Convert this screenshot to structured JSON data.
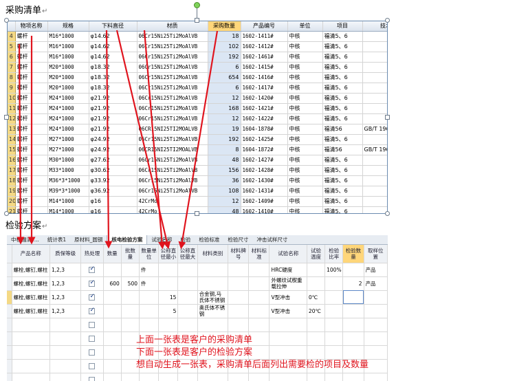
{
  "purchase_heading": "采购清单",
  "plan_heading": "检验方案",
  "para_mark": "↵",
  "purchase": {
    "columns": [
      "物项名称",
      "规格",
      "下料直径",
      "材质",
      "采购数量",
      "产品编号",
      "单位",
      "项目",
      "技术参数"
    ],
    "rows": [
      [
        "4",
        "螺杆",
        "M16*1000",
        "φ14.62",
        "06Cr15Ni25Ti2MoAlVB",
        "18",
        "1602-1411#",
        "中核",
        "福清5、6",
        ""
      ],
      [
        "5",
        "螺杆",
        "M16*1000",
        "φ14.62",
        "06Cr15Ni25Ti2MoAlVB",
        "102",
        "1602-1412#",
        "中核",
        "福清5、6",
        ""
      ],
      [
        "6",
        "螺杆",
        "M16*1000",
        "φ14.62",
        "06Cr15Ni25Ti2MoAlVB",
        "192",
        "1602-1461#",
        "中核",
        "福清5、6",
        ""
      ],
      [
        "7",
        "螺杆",
        "M20*1000",
        "φ18.32",
        "06Cr15Ni25Ti2MoAlVB",
        "6",
        "1602-1415#",
        "中核",
        "福清5、6",
        ""
      ],
      [
        "8",
        "螺杆",
        "M20*1000",
        "φ18.32",
        "06Cr15Ni25Ti2MoAlVB",
        "654",
        "1602-1416#",
        "中核",
        "福清5、6",
        ""
      ],
      [
        "9",
        "螺杆",
        "M20*1000",
        "φ18.32",
        "06Cr15Ni25Ti2MoAlVB",
        "6",
        "1602-1417#",
        "中核",
        "福清5、6",
        ""
      ],
      [
        "10",
        "螺杆",
        "M24*1000",
        "φ21.92",
        "06Cr15Ni25Ti2MoAlVB",
        "12",
        "1602-1420#",
        "中核",
        "福清5、6",
        ""
      ],
      [
        "11",
        "螺杆",
        "M24*1000",
        "φ21.92",
        "06Cr15Ni25Ti2MoAlVB",
        "168",
        "1602-1421#",
        "中核",
        "福清5、6",
        ""
      ],
      [
        "12",
        "螺杆",
        "M24*1000",
        "φ21.92",
        "06Cr15Ni25Ti2MoAlVB",
        "12",
        "1602-1422#",
        "中核",
        "福清5、6",
        ""
      ],
      [
        "13",
        "螺杆",
        "M24*1000",
        "φ21.92",
        "06CR15NI25TI2MOALVB",
        "19",
        "1604-1878#",
        "中核",
        "福清56",
        "GB/T 196"
      ],
      [
        "14",
        "螺杆",
        "M27*1000",
        "φ24.92",
        "06Cr15Ni25Ti2MoAlVB",
        "192",
        "1602-1425#",
        "中核",
        "福清5、6",
        ""
      ],
      [
        "15",
        "螺杆",
        "M27*1000",
        "φ24.92",
        "06CR15NI25TI2MOALVB",
        "8",
        "1604-1872#",
        "中核",
        "福清56",
        "GB/T 196"
      ],
      [
        "16",
        "螺杆",
        "M30*1000",
        "φ27.62",
        "06Cr15Ni25Ti2MoAlVB",
        "48",
        "1602-1427#",
        "中核",
        "福清5、6",
        ""
      ],
      [
        "17",
        "螺杆",
        "M33*1000",
        "φ30.62",
        "06Cr15Ni25Ti2MoAlVB",
        "156",
        "1602-1428#",
        "中核",
        "福清5、6",
        ""
      ],
      [
        "18",
        "螺杆",
        "M36*3*1000",
        "φ33.92",
        "06Cr15Ni25Ti2MoAlVB",
        "36",
        "1602-1430#",
        "中核",
        "福清5、6",
        ""
      ],
      [
        "19",
        "螺杆",
        "M39*3*1000",
        "φ36.92",
        "06Cr15Ni25Ti2MoAlVB",
        "108",
        "1602-1431#",
        "中核",
        "福清5、6",
        ""
      ],
      [
        "20",
        "螺杆",
        "M14*1000",
        "φ16",
        "42CrMo",
        "12",
        "1602-1409#",
        "中核",
        "福清5、6",
        ""
      ],
      [
        "21",
        "螺杆",
        "M14*1000",
        "φ16",
        "42CrMo",
        "48",
        "1602-1410#",
        "中核",
        "福清5、6",
        ""
      ]
    ]
  },
  "plan": {
    "tabs": [
      "中核福清T...",
      "统计表1",
      "原材料_圆钢",
      "核电检验方案",
      "试验名称",
      "检验",
      "检验标准",
      "检验尺寸",
      "冲击试样尺寸"
    ],
    "active_tab": 3,
    "columns": [
      "产品名称",
      "质保等级",
      "热处理",
      "数量",
      "批数量",
      "数量单位",
      "公称直径最小",
      "公称直径最大",
      "材料类别",
      "材料牌号",
      "材料标准",
      "试验名称",
      "试验温度",
      "检验比率",
      "检验数量",
      "取样位置"
    ],
    "rows": [
      {
        "name": "螺栓,螺钉,螺柱",
        "grade": "1,2,3",
        "heat": true,
        "qty": "",
        "batch": "",
        "unit": "件",
        "dmin": "",
        "dmax": "",
        "mcat": "",
        "mgrade": "",
        "mstd": "",
        "test": "HRC硬度",
        "temp": "",
        "ratio": "100%",
        "tqty": "",
        "pos": "产品"
      },
      {
        "name": "螺栓,螺钉,螺柱",
        "grade": "1,2,3",
        "heat": true,
        "qty": "600",
        "batch": "500",
        "unit": "件",
        "dmin": "",
        "dmax": "",
        "mcat": "",
        "mgrade": "",
        "mstd": "",
        "test": "外螺纹试楔重载拉伸",
        "temp": "",
        "ratio": "",
        "tqty": "2",
        "pos": "产品"
      },
      {
        "name": "螺栓,螺钉,螺柱",
        "grade": "1,2,3",
        "heat": true,
        "qty": "",
        "batch": "",
        "unit": "",
        "dmin": "15",
        "dmax": "",
        "mcat": "合金钢,马氏体不锈钢",
        "mgrade": "",
        "mstd": "",
        "test": "V型冲击",
        "temp": "0℃",
        "ratio": "",
        "tqty": "",
        "pos": ""
      },
      {
        "name": "螺栓,螺钉,螺柱",
        "grade": "1,2,3",
        "heat": true,
        "qty": "",
        "batch": "",
        "unit": "",
        "dmin": "5",
        "dmax": "",
        "mcat": "奥氏体不锈钢",
        "mgrade": "",
        "mstd": "",
        "test": "V型冲击",
        "temp": "20℃",
        "ratio": "",
        "tqty": "",
        "pos": ""
      },
      {
        "name": "",
        "grade": "",
        "heat": false,
        "qty": "",
        "batch": "",
        "unit": "",
        "dmin": "",
        "dmax": "",
        "mcat": "",
        "mgrade": "",
        "mstd": "",
        "test": "",
        "temp": "",
        "ratio": "",
        "tqty": "",
        "pos": ""
      },
      {
        "name": "",
        "grade": "",
        "heat": false,
        "qty": "",
        "batch": "",
        "unit": "",
        "dmin": "",
        "dmax": "",
        "mcat": "",
        "mgrade": "",
        "mstd": "",
        "test": "",
        "temp": "",
        "ratio": "",
        "tqty": "",
        "pos": ""
      },
      {
        "name": "",
        "grade": "",
        "heat": false,
        "qty": "",
        "batch": "",
        "unit": "",
        "dmin": "",
        "dmax": "",
        "mcat": "",
        "mgrade": "",
        "mstd": "",
        "test": "",
        "temp": "",
        "ratio": "",
        "tqty": "",
        "pos": ""
      },
      {
        "name": "",
        "grade": "",
        "heat": false,
        "qty": "",
        "batch": "",
        "unit": "",
        "dmin": "",
        "dmax": "",
        "mcat": "",
        "mgrade": "",
        "mstd": "",
        "test": "",
        "temp": "",
        "ratio": "",
        "tqty": "",
        "pos": ""
      },
      {
        "name": "",
        "grade": "",
        "heat": false,
        "qty": "",
        "batch": "",
        "unit": "",
        "dmin": "",
        "dmax": "",
        "mcat": "",
        "mgrade": "",
        "mstd": "",
        "test": "",
        "temp": "",
        "ratio": "",
        "tqty": "",
        "pos": ""
      }
    ]
  },
  "note_lines": [
    "上面一张表是客户的采购清单",
    "下面一张表是客户的检验方案",
    "想自动生成一张表，采购清单后面列出需要检的项目及数量"
  ],
  "colors": {
    "annotation": "#e0141e",
    "selected_column": "#ffd67a",
    "row_numbers": "#f4d985",
    "selection_fill": "#dbe6f4"
  }
}
